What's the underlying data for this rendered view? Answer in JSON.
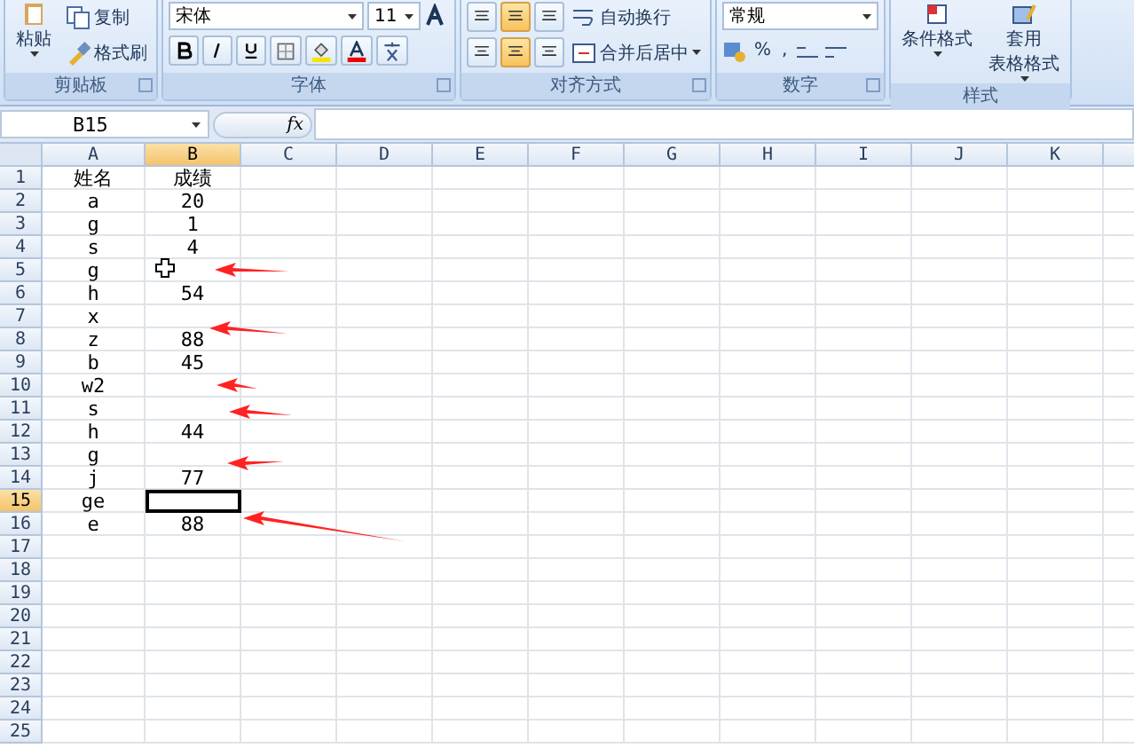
{
  "ribbon": {
    "groups": [
      {
        "kind": "clipboard",
        "label": "剪贴板",
        "paste": "粘贴",
        "copy": "复制",
        "format_painter": "格式刷"
      },
      {
        "kind": "font",
        "label": "字体",
        "font_name": "宋体",
        "font_size": "11"
      },
      {
        "kind": "alignment",
        "label": "对齐方式",
        "wrap_text": "自动换行",
        "merge_center": "合并后居中"
      },
      {
        "kind": "number",
        "label": "数字",
        "format": "常规",
        "percent": "%",
        "comma": ","
      },
      {
        "kind": "styles",
        "label": "样式",
        "conditional": "条件格式",
        "table_format_1": "套用",
        "table_format_2": "表格格式"
      }
    ]
  },
  "formula_bar": {
    "name_box": "B15",
    "fx": "fx"
  },
  "sheet": {
    "columns": [
      {
        "label": "A",
        "selected": false
      },
      {
        "label": "B",
        "selected": true
      },
      {
        "label": "C",
        "selected": false
      },
      {
        "label": "D",
        "selected": false
      },
      {
        "label": "E",
        "selected": false
      },
      {
        "label": "F",
        "selected": false
      },
      {
        "label": "G",
        "selected": false
      },
      {
        "label": "H",
        "selected": false
      },
      {
        "label": "I",
        "selected": false
      },
      {
        "label": "J",
        "selected": false
      },
      {
        "label": "K",
        "selected": false
      }
    ],
    "rows": [
      {
        "number": "1",
        "selected": false,
        "cells": {
          "A": "姓名",
          "B": "成绩"
        }
      },
      {
        "number": "2",
        "selected": false,
        "cells": {
          "A": "a",
          "B": "20"
        }
      },
      {
        "number": "3",
        "selected": false,
        "cells": {
          "A": "g",
          "B": "1"
        }
      },
      {
        "number": "4",
        "selected": false,
        "cells": {
          "A": "s",
          "B": "4"
        }
      },
      {
        "number": "5",
        "selected": false,
        "cells": {
          "A": "g"
        }
      },
      {
        "number": "6",
        "selected": false,
        "cells": {
          "A": "h",
          "B": "54"
        }
      },
      {
        "number": "7",
        "selected": false,
        "cells": {
          "A": "x"
        }
      },
      {
        "number": "8",
        "selected": false,
        "cells": {
          "A": "z",
          "B": "88"
        }
      },
      {
        "number": "9",
        "selected": false,
        "cells": {
          "A": "b",
          "B": "45"
        }
      },
      {
        "number": "10",
        "selected": false,
        "cells": {
          "A": "w2"
        }
      },
      {
        "number": "11",
        "selected": false,
        "cells": {
          "A": "s"
        }
      },
      {
        "number": "12",
        "selected": false,
        "cells": {
          "A": "h",
          "B": "44"
        }
      },
      {
        "number": "13",
        "selected": false,
        "cells": {
          "A": "g"
        }
      },
      {
        "number": "14",
        "selected": false,
        "cells": {
          "A": "j",
          "B": "77"
        }
      },
      {
        "number": "15",
        "selected": true,
        "cells": {
          "A": "ge"
        }
      },
      {
        "number": "16",
        "selected": false,
        "cells": {
          "A": "e",
          "B": "88"
        }
      },
      {
        "number": "17",
        "selected": false,
        "cells": {}
      },
      {
        "number": "18",
        "selected": false,
        "cells": {}
      },
      {
        "number": "19",
        "selected": false,
        "cells": {}
      },
      {
        "number": "20",
        "selected": false,
        "cells": {}
      },
      {
        "number": "21",
        "selected": false,
        "cells": {}
      },
      {
        "number": "22",
        "selected": false,
        "cells": {}
      },
      {
        "number": "23",
        "selected": false,
        "cells": {}
      },
      {
        "number": "24",
        "selected": false,
        "cells": {}
      },
      {
        "number": "25",
        "selected": false,
        "cells": {}
      }
    ]
  }
}
